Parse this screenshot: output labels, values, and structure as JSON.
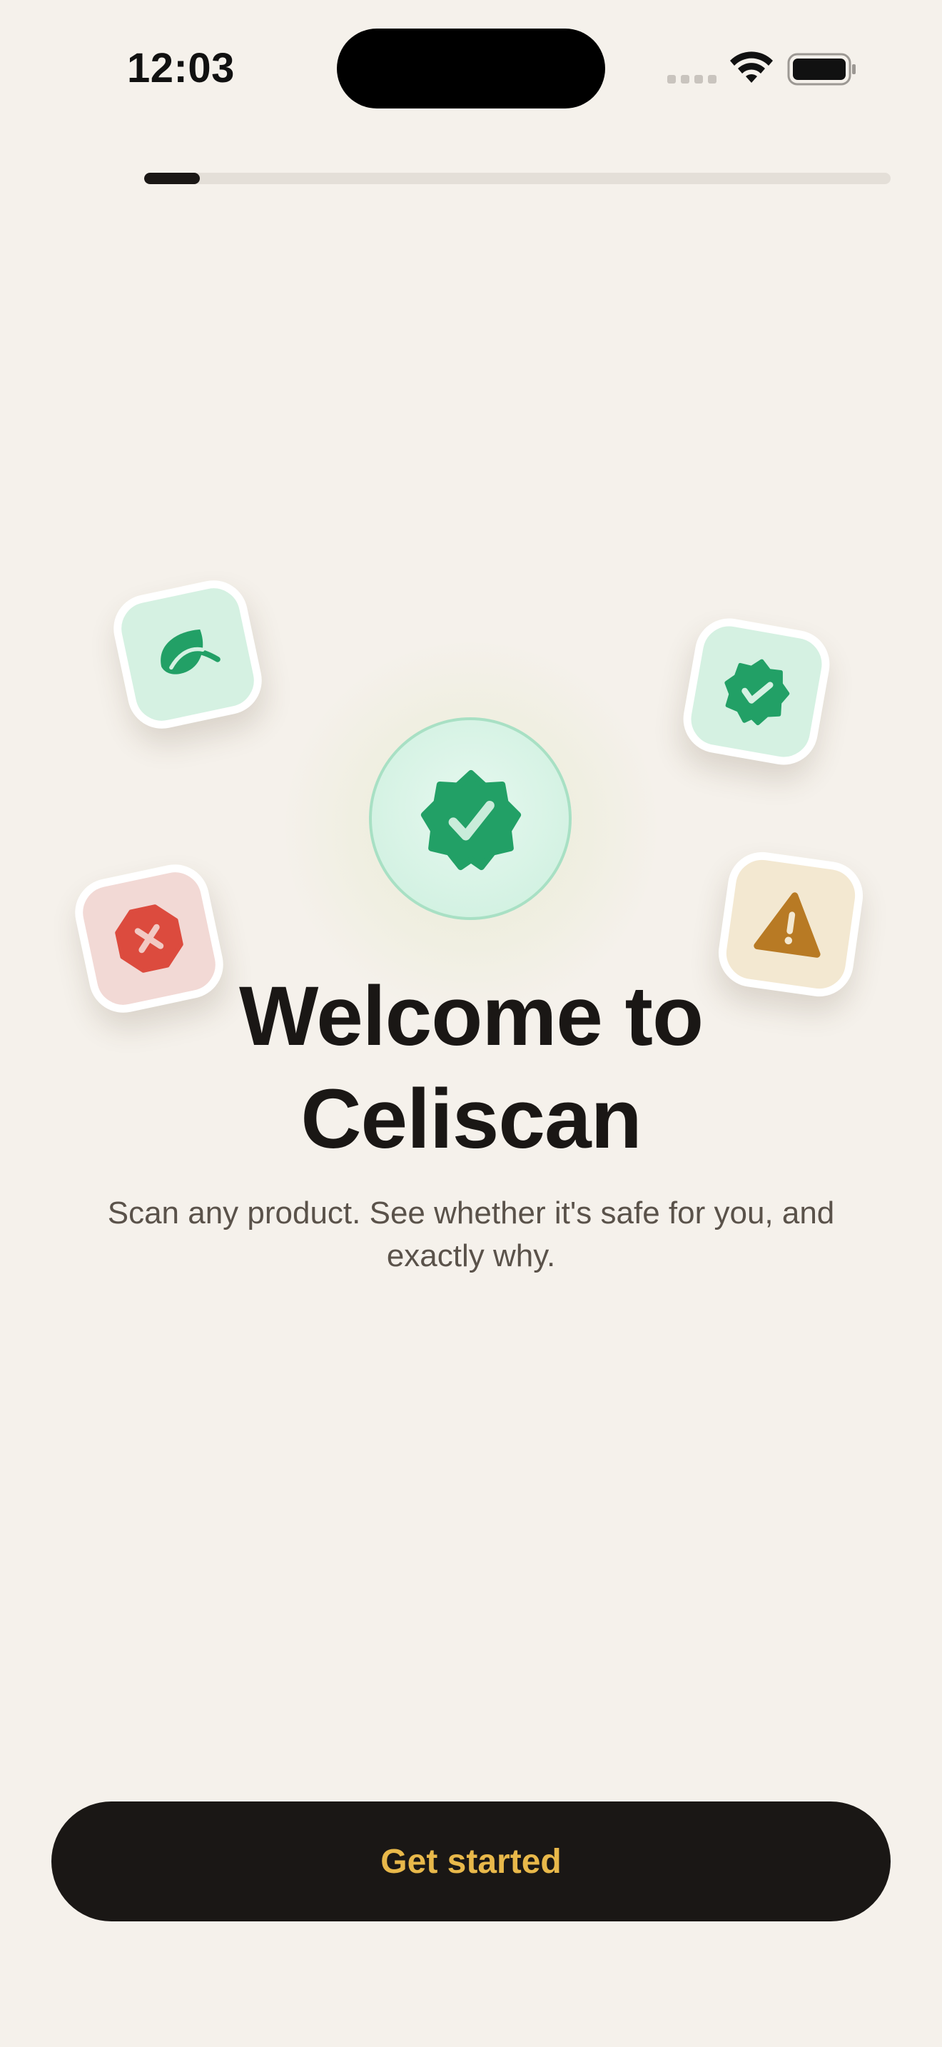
{
  "status_bar": {
    "time": "12:03",
    "icons": [
      "cellular-signal-icon",
      "wifi-icon",
      "battery-icon"
    ]
  },
  "onboarding": {
    "progress": 0.075,
    "title_line1": "Welcome to",
    "title_line2": "Celiscan",
    "subtitle": "Scan any product. See whether it's safe for you, and exactly why.",
    "cta_label": "Get started"
  },
  "hero": {
    "center_icon": "verified-badge-icon",
    "floating_icons": [
      "leaf-icon",
      "verified-badge-small-icon",
      "error-octagon-icon",
      "warning-triangle-icon"
    ]
  },
  "colors": {
    "background": "#F5F1EB",
    "safe_green": "#22A066",
    "danger_red": "#DC4B3E",
    "warning_amber": "#B87A24",
    "cta_text": "#E8B84A",
    "dark": "#1A1715"
  }
}
